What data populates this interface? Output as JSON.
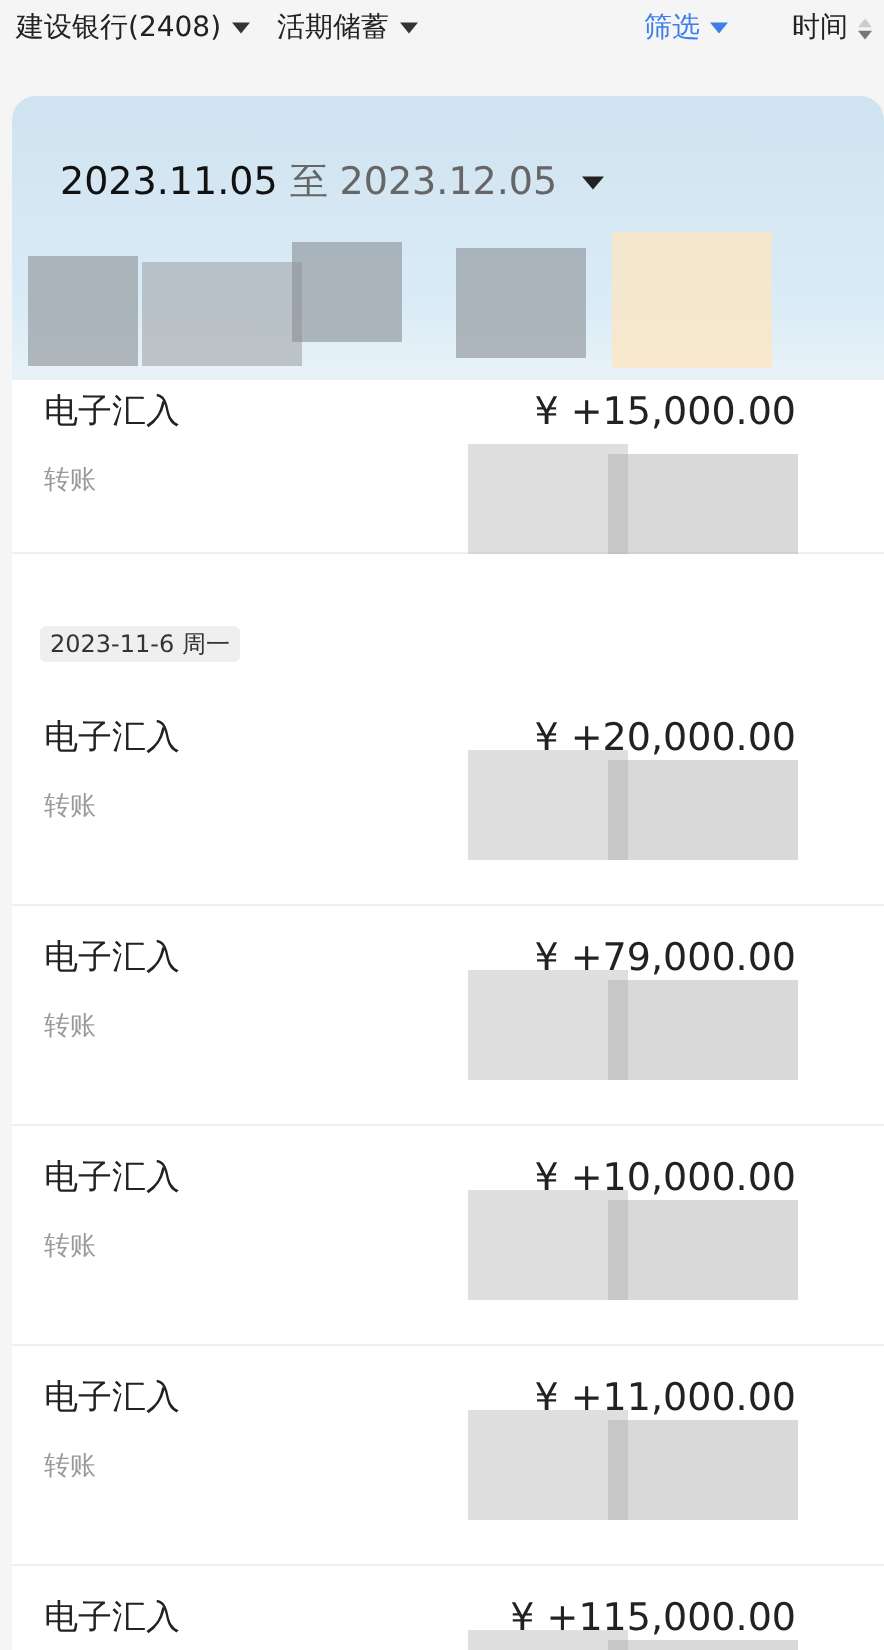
{
  "top_bar": {
    "account": "建设银行(2408)",
    "account_type": "活期储蓄",
    "filter": {
      "label": "筛选",
      "selected": true
    },
    "sort": "时间"
  },
  "date_range": {
    "start": "2023.11.05",
    "separator": "至",
    "end": "2023.12.05"
  },
  "groups": [
    {
      "transactions": [
        {
          "title": "电子汇入",
          "amount": "¥ +15,000.00",
          "category": "转账"
        }
      ]
    },
    {
      "date": "2023-11-6 周一",
      "transactions": [
        {
          "title": "电子汇入",
          "amount": "¥ +20,000.00",
          "category": "转账"
        },
        {
          "title": "电子汇入",
          "amount": "¥ +79,000.00",
          "category": "转账"
        },
        {
          "title": "电子汇入",
          "amount": "¥ +10,000.00",
          "category": "转账"
        },
        {
          "title": "电子汇入",
          "amount": "¥ +11,000.00",
          "category": "转账"
        },
        {
          "title": "电子汇入",
          "amount": "¥ +115,000.00"
        }
      ]
    }
  ]
}
